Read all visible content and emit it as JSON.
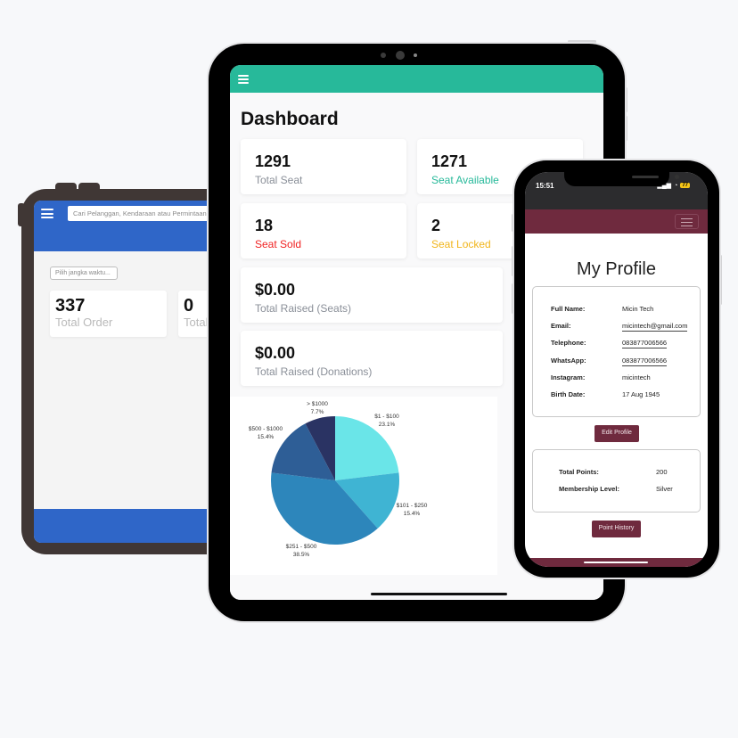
{
  "left_tablet": {
    "search_placeholder": "Cari Pelanggan, Kendaraan atau Permintaan",
    "range_placeholder": "Pilih jangka waktu...",
    "stats": [
      {
        "value": "337",
        "label": "Total Order"
      },
      {
        "value": "0",
        "label": "Total"
      }
    ],
    "colors": {
      "header": "#2f66c8",
      "frame": "#403735"
    }
  },
  "center_tablet": {
    "title": "Dashboard",
    "stats": [
      {
        "value": "1291",
        "label": "Total Seat",
        "color": "#8a8f98"
      },
      {
        "value": "1271",
        "label": "Seat Available",
        "color": "#27b99a"
      },
      {
        "value": "18",
        "label": "Seat Sold",
        "color": "#f02222"
      },
      {
        "value": "2",
        "label": "Seat Locked",
        "color": "#f1b51c"
      },
      {
        "value": "$0.00",
        "label": "Total Raised (Seats)",
        "color": "#8a8f98"
      },
      {
        "value": "$0.00",
        "label": "Total Raised (Donations)",
        "color": "#8a8f98"
      }
    ],
    "colors": {
      "header": "#27b99a"
    }
  },
  "chart_data": {
    "type": "pie",
    "title": "",
    "slices": [
      {
        "label": "$1 - $100",
        "percent": 23.1,
        "display": "23.1%",
        "color": "#6ae5e8"
      },
      {
        "label": "$101 - $250",
        "percent": 15.4,
        "display": "15.4%",
        "color": "#3fb4d3"
      },
      {
        "label": "$251 - $500",
        "percent": 38.5,
        "display": "38.5%",
        "color": "#2d86bb"
      },
      {
        "label": "$500 - $1000",
        "percent": 15.4,
        "display": "15.4%",
        "color": "#2e5e96"
      },
      {
        "label": "> $1000",
        "percent": 7.7,
        "display": "7.7%",
        "color": "#2a3363"
      }
    ]
  },
  "phone": {
    "status_time": "15:51",
    "battery": "77",
    "title": "My Profile",
    "profile_fields": [
      {
        "label": "Full Name:",
        "value": "Micin Tech",
        "link": false
      },
      {
        "label": "Email:",
        "value": "micintech@gmail.com",
        "link": true
      },
      {
        "label": "Telephone:",
        "value": "083877006566",
        "link": true
      },
      {
        "label": "WhatsApp:",
        "value": "083877006566",
        "link": true
      },
      {
        "label": "Instagram:",
        "value": "micintech",
        "link": false
      },
      {
        "label": "Birth Date:",
        "value": "17 Aug 1945",
        "link": false
      }
    ],
    "edit_button": "Edit Profile",
    "points_fields": [
      {
        "label": "Total Points:",
        "value": "200"
      },
      {
        "label": "Membership Level:",
        "value": "Silver"
      }
    ],
    "history_button": "Point History",
    "colors": {
      "brand": "#6f2a3e"
    }
  }
}
